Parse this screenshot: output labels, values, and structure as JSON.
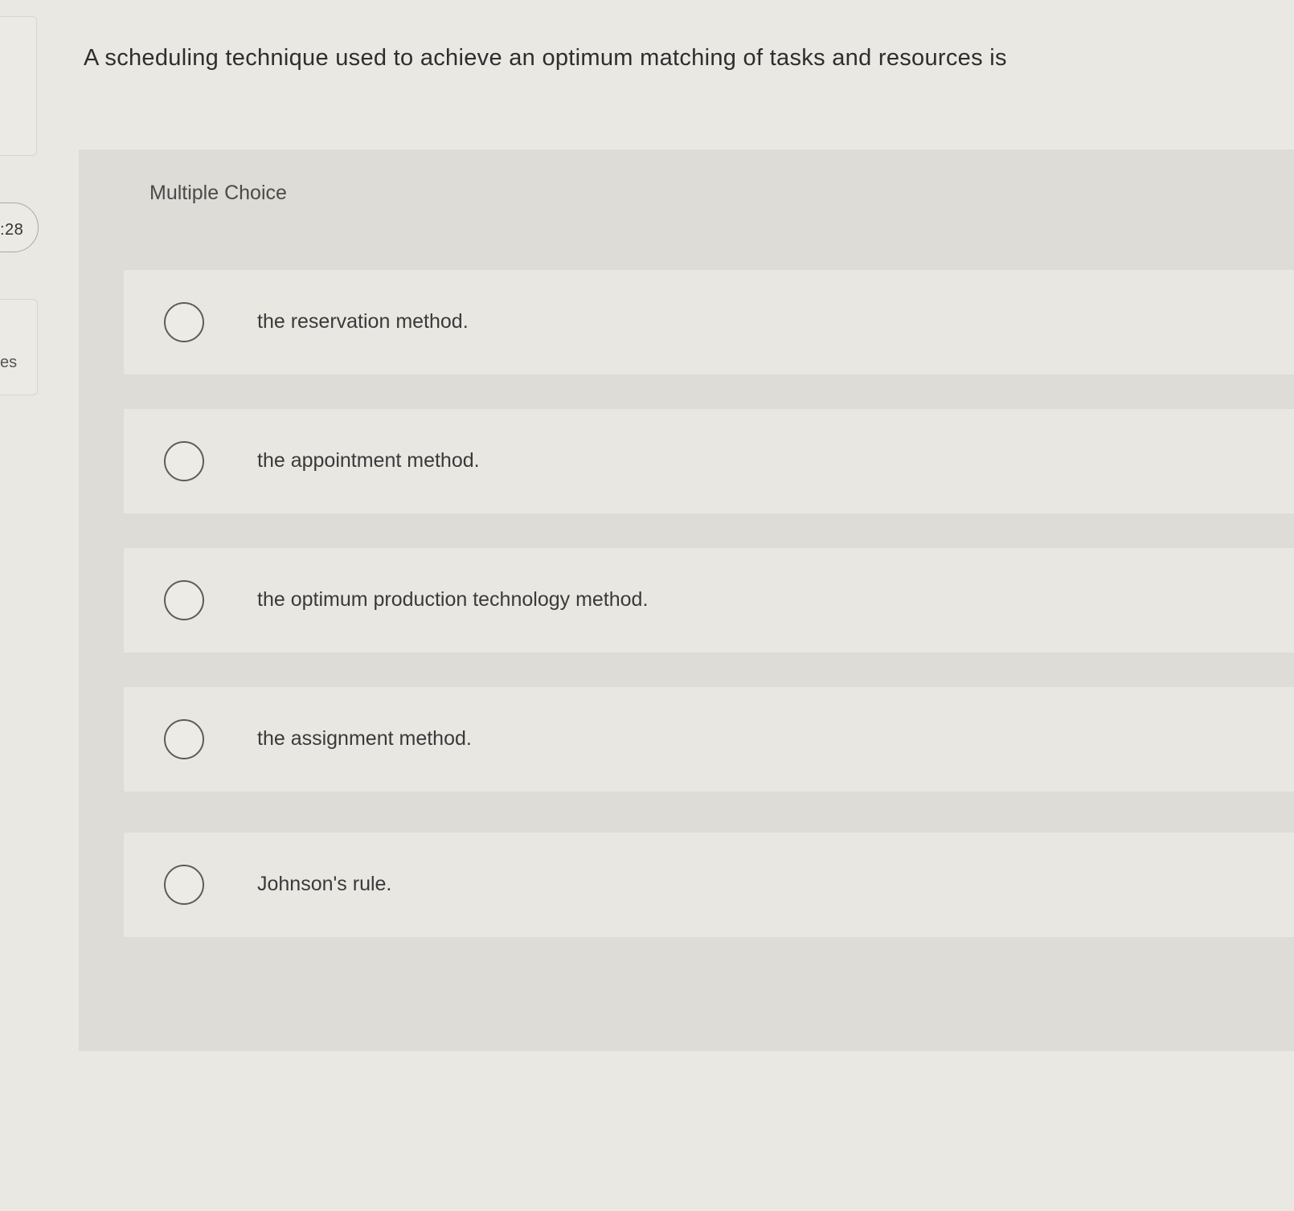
{
  "sidebar": {
    "timer": ":28",
    "partial_label": "es"
  },
  "question": {
    "text": "A scheduling technique used to achieve an optimum matching of tasks and resources is"
  },
  "multiple_choice": {
    "label": "Multiple Choice",
    "options": [
      {
        "label": "the reservation method."
      },
      {
        "label": "the appointment method."
      },
      {
        "label": "the optimum production technology method."
      },
      {
        "label": "the assignment method."
      },
      {
        "label": "Johnson's rule."
      }
    ]
  }
}
